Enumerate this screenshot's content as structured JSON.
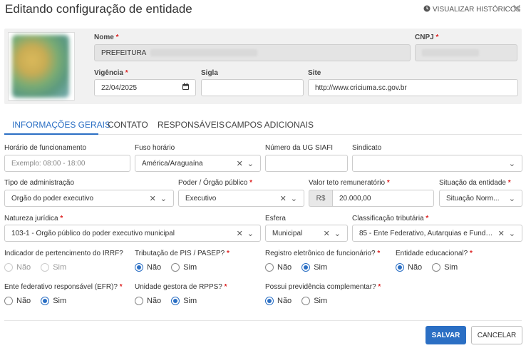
{
  "dialog": {
    "title": "Editando configuração de entidade",
    "history_label": "VISUALIZAR HISTÓRICOS",
    "close_glyph": "✕"
  },
  "header": {
    "nome_label": "Nome",
    "nome_value": "PREFEITURA",
    "cnpj_label": "CNPJ",
    "vigencia_label": "Vigência",
    "vigencia_value": "22/04/2025",
    "sigla_label": "Sigla",
    "sigla_value": "",
    "site_label": "Site",
    "site_value": "http://www.criciuma.sc.gov.br"
  },
  "tabs": [
    {
      "label": "INFORMAÇÕES GERAIS",
      "active": true
    },
    {
      "label": "CONTATO",
      "active": false
    },
    {
      "label": "RESPONSÁVEIS",
      "active": false
    },
    {
      "label": "CAMPOS ADICIONAIS",
      "active": false
    }
  ],
  "fields": {
    "horario_label": "Horário de funcionamento",
    "horario_placeholder": "Exemplo: 08:00 - 18:00",
    "fuso_label": "Fuso horário",
    "fuso_value": "América/Araguaína",
    "ug_label": "Número da UG SIAFI",
    "ug_value": "",
    "sindicato_label": "Sindicato",
    "sindicato_value": "",
    "tipo_label": "Tipo de administração",
    "tipo_value": "Órgão do poder executivo",
    "poder_label": "Poder / Órgão público",
    "poder_value": "Executivo",
    "teto_label": "Valor teto remuneratório",
    "teto_prefix": "R$",
    "teto_value": "20.000,00",
    "situacao_label": "Situação da entidade",
    "situacao_value": "Situação Norm...",
    "natureza_label": "Natureza jurídica",
    "natureza_value": "103-1 - Órgão público do poder executivo municipal",
    "esfera_label": "Esfera",
    "esfera_value": "Municipal",
    "classificacao_label": "Classificação tributária",
    "classificacao_value": "85 - Ente Federativo, Autarquias e Fundaç..."
  },
  "radios": {
    "irrf_label": "Indicador de pertencimento do IRRF?",
    "pis_label": "Tributação de PIS / PASEP?",
    "registro_label": "Registro eletrônico de funcionário?",
    "educacional_label": "Entidade educacional?",
    "efr_label": "Ente federativo responsável (EFR)?",
    "rpps_label": "Unidade gestora de RPPS?",
    "previdencia_label": "Possui previdência complementar?",
    "nao": "Não",
    "sim": "Sim"
  },
  "footer": {
    "save_label": "SALVAR",
    "cancel_label": "CANCELAR"
  },
  "required_mark": "*",
  "colors": {
    "accent": "#2b6fc4",
    "required": "#dd2222"
  }
}
